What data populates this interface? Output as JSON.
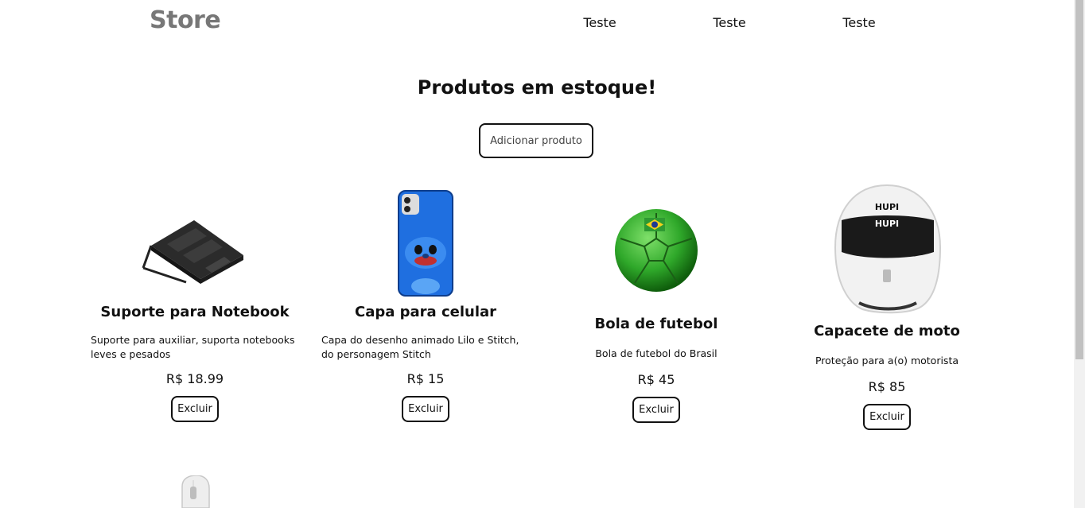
{
  "header": {
    "brand": "Store",
    "nav": [
      "Teste",
      "Teste",
      "Teste"
    ]
  },
  "main": {
    "headline": "Produtos em estoque!",
    "add_button": "Adicionar produto"
  },
  "products": [
    {
      "title": "Suporte para Notebook",
      "description": "Suporte para auxiliar, suporta notebooks leves e pesados",
      "price": "R$ 18.99",
      "delete_label": "Excluir",
      "image_icon": "laptop-stand-image"
    },
    {
      "title": "Capa para celular",
      "description": "Capa do desenho animado Lilo e Stitch, do personagem Stitch",
      "price": "R$ 15",
      "delete_label": "Excluir",
      "image_icon": "phone-case-image"
    },
    {
      "title": "Bola de futebol",
      "description": "Bola de futebol do Brasil",
      "price": "R$ 45",
      "delete_label": "Excluir",
      "image_icon": "soccer-ball-image"
    },
    {
      "title": "Capacete de moto",
      "description": "Proteção para a(o) motorista",
      "price": "R$ 85",
      "delete_label": "Excluir",
      "image_icon": "motorcycle-helmet-image",
      "image_text": "HUPI"
    },
    {
      "image_icon": "computer-mouse-image"
    }
  ],
  "colors": {
    "brand": "#777777",
    "text": "#111111",
    "border": "#111111",
    "ball_green": "#2fa82a",
    "case_blue": "#1f6fe0"
  }
}
